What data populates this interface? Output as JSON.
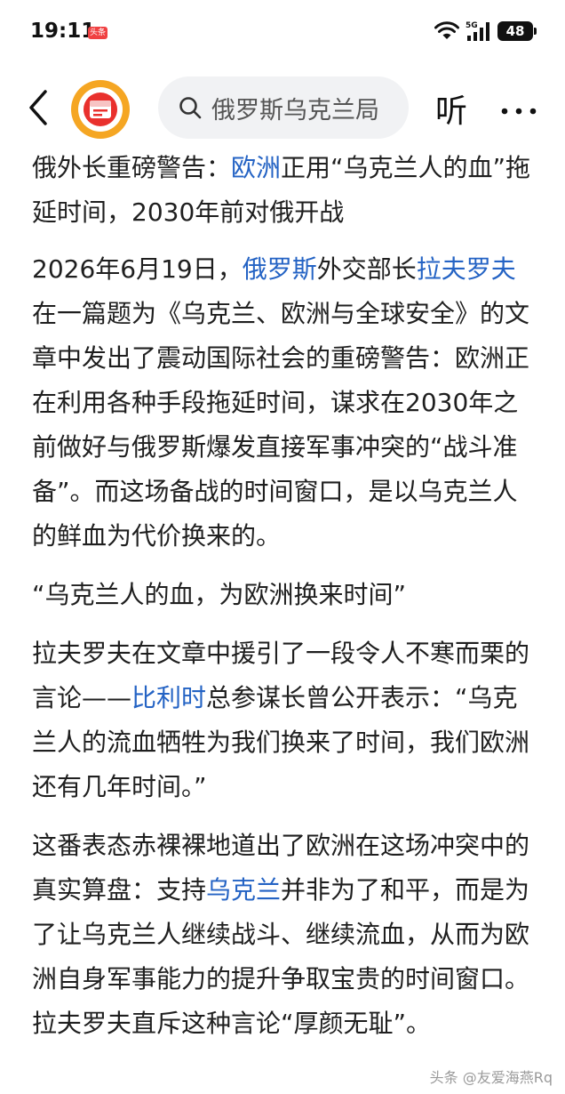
{
  "status_bar": {
    "time": "19:11",
    "app_badge": "头条",
    "network": "5G",
    "battery": "48"
  },
  "header": {
    "search_text": "俄罗斯乌克兰局",
    "listen_label": "听",
    "logo_color": "#f5a623",
    "accent_red": "#e9302d"
  },
  "article": {
    "title": {
      "t1": "俄外长重磅警告：",
      "link1": "欧洲",
      "t2": "正用“乌克兰人的血”拖延时间，2030年前对俄开战"
    },
    "p1": {
      "t1": "2026年6月19日，",
      "link1": "俄罗斯",
      "t2": "外交部长",
      "link2": "拉夫罗夫",
      "t3": "在一篇题为《乌克兰、欧洲与全球安全》的文章中发出了震动国际社会的重磅警告：欧洲正在利用各种手段拖延时间，谋求在2030年之前做好与俄罗斯爆发直接军事冲突的“战斗准备”。而这场备战的时间窗口，是以乌克兰人的鲜血为代价换来的。"
    },
    "subheading": "“乌克兰人的血，为欧洲换来时间”",
    "p2": {
      "t1": "拉夫罗夫在文章中援引了一段令人不寒而栗的言论——",
      "link1": "比利时",
      "t2": "总参谋长曾公开表示：“乌克兰人的流血牺牲为我们换来了时间，我们欧洲还有几年时间。”"
    },
    "p3": {
      "t1": "这番表态赤裸裸地道出了欧洲在这场冲突中的真实算盘：支持",
      "link1": "乌克兰",
      "t2": "并非为了和平，而是为了让乌克兰人继续战斗、继续流血，从而为欧洲自身军事能力的提升争取宝贵的时间窗口。拉夫罗夫直斥这种言论“厚颜无耻”。"
    },
    "link_color": "#2463c4"
  },
  "watermark": "头条 @友爱海燕Rq"
}
